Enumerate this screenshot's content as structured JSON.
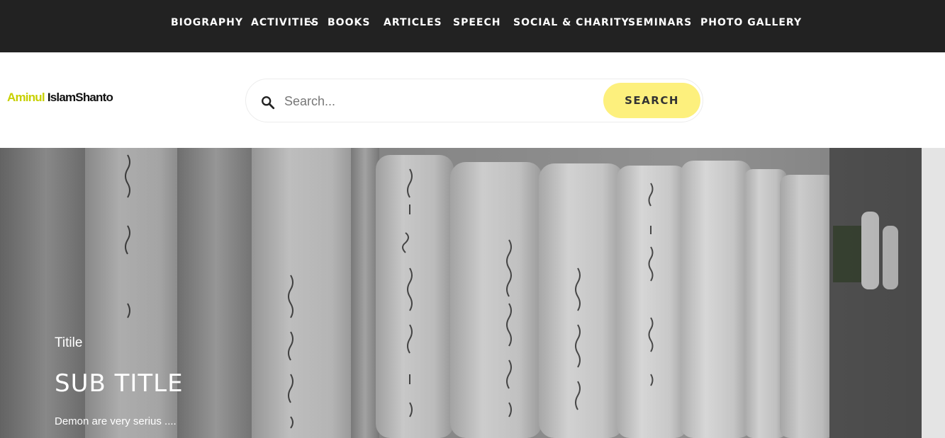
{
  "nav": {
    "items": [
      {
        "label": "BIOGRAPHY"
      },
      {
        "label": "ACTIVITIES",
        "has_dropdown": true
      },
      {
        "label": "BOOKS"
      },
      {
        "label": "ARTICLES"
      },
      {
        "label": "SPEECH"
      },
      {
        "label": "SOCIAL & CHARITY"
      },
      {
        "label": "SEMINARS"
      },
      {
        "label": "PHOTO GALLERY"
      }
    ],
    "dropdown_icon": "chevron-down-icon",
    "background": "#222222",
    "text_color": "#ffffff"
  },
  "header": {
    "logo": {
      "part1": "Aminul",
      "part2": "IslamShanto",
      "part1_color": "#c8d000",
      "part2_color": "#111111"
    },
    "search": {
      "placeholder": "Search...",
      "value": "",
      "button_label": "SEARCH",
      "icon": "search-icon",
      "button_color": "#fdf07d"
    }
  },
  "hero": {
    "title": "Titile",
    "subtitle": "SUB TITLE",
    "description": "Demon are very serius ....",
    "background_image": "book-spines-photo"
  }
}
